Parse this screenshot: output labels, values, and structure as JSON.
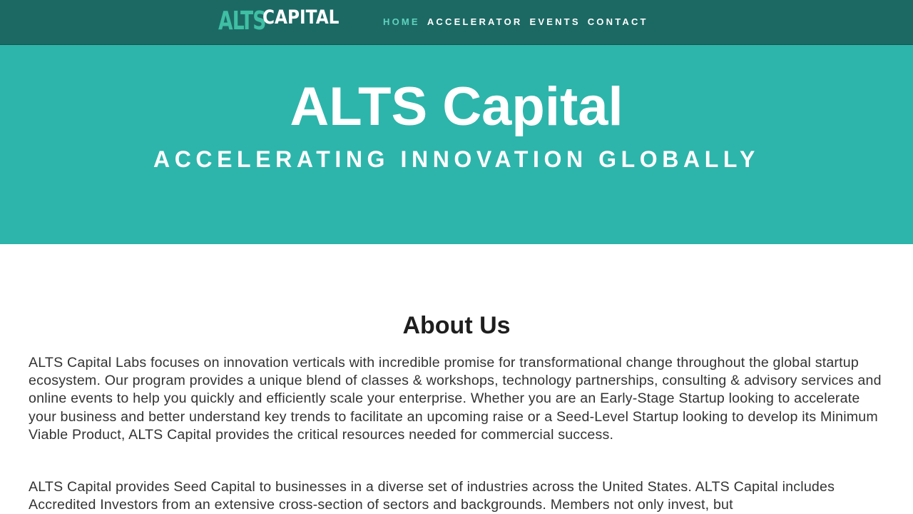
{
  "brand": {
    "logo_part1": "ALTS",
    "logo_part2": "CAPITAL",
    "logo_color_accent": "#3fbfa4"
  },
  "nav": {
    "items": [
      {
        "label": "HOME",
        "active": true
      },
      {
        "label": "ACCELERATOR",
        "active": false
      },
      {
        "label": "EVENTS",
        "active": false
      },
      {
        "label": "CONTACT",
        "active": false
      }
    ]
  },
  "hero": {
    "title": "ALTS Capital",
    "subtitle": "ACCELERATING INNOVATION GLOBALLY",
    "background": "#2db5ab"
  },
  "about": {
    "heading": "About Us",
    "paragraph1": "ALTS Capital Labs focuses on innovation verticals with incredible promise for transformational change throughout the global startup ecosystem. Our program provides a unique blend of classes & workshops, technology partnerships, consulting & advisory services and online events to help you quickly and efficiently scale your enterprise. Whether you are an Early-Stage Startup looking to accelerate your business and better understand key trends to facilitate an upcoming raise or a Seed-Level Startup looking to develop its Minimum Viable Product, ALTS Capital provides the critical resources needed for commercial success.",
    "paragraph2": "ALTS Capital provides Seed Capital to businesses in a diverse set of industries across the United States. ALTS Capital includes Accredited Investors from an extensive cross-section of sectors and backgrounds. Members not only invest, but"
  },
  "colors": {
    "header_bg": "#1c6964",
    "nav_active": "#5fd3bd"
  }
}
